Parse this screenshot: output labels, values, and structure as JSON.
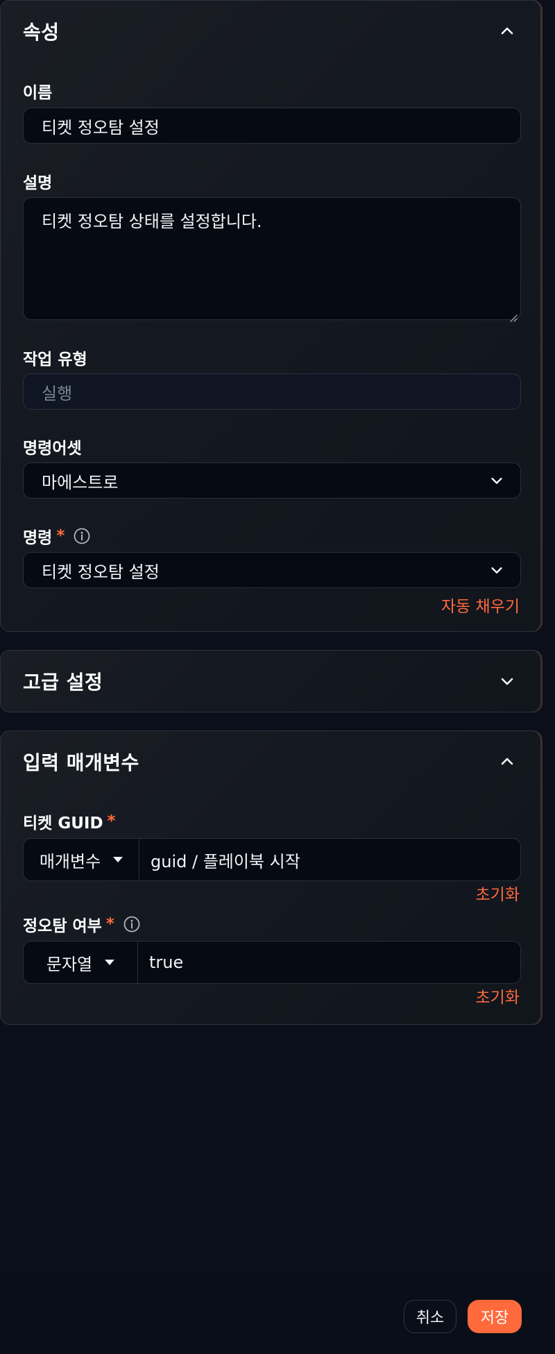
{
  "properties": {
    "title": "속성",
    "name_label": "이름",
    "name_value": "티켓 정오탐 설정",
    "description_label": "설명",
    "description_value": "티켓 정오탐 상태를 설정합니다.",
    "task_type_label": "작업 유형",
    "task_type_placeholder": "실행",
    "command_asset_label": "명령어셋",
    "command_asset_value": "마에스트로",
    "command_label": "명령",
    "required_mark": "*",
    "command_value": "티켓 정오탐 설정",
    "autofill_label": "자동 채우기"
  },
  "advanced": {
    "title": "고급 설정"
  },
  "input_params": {
    "title": "입력 매개변수",
    "params": [
      {
        "label": "티켓 GUID",
        "required_mark": "*",
        "type": "매개변수",
        "value": "guid / 플레이북 시작",
        "reset_label": "초기화"
      },
      {
        "label": "정오탐 여부",
        "required_mark": "*",
        "type": "문자열",
        "value": "true",
        "reset_label": "초기화"
      }
    ]
  },
  "footer": {
    "cancel_label": "취소",
    "save_label": "저장"
  },
  "colors": {
    "accent": "#ff6a3d",
    "background": "#0b0f19",
    "field_background": "#060a12"
  }
}
